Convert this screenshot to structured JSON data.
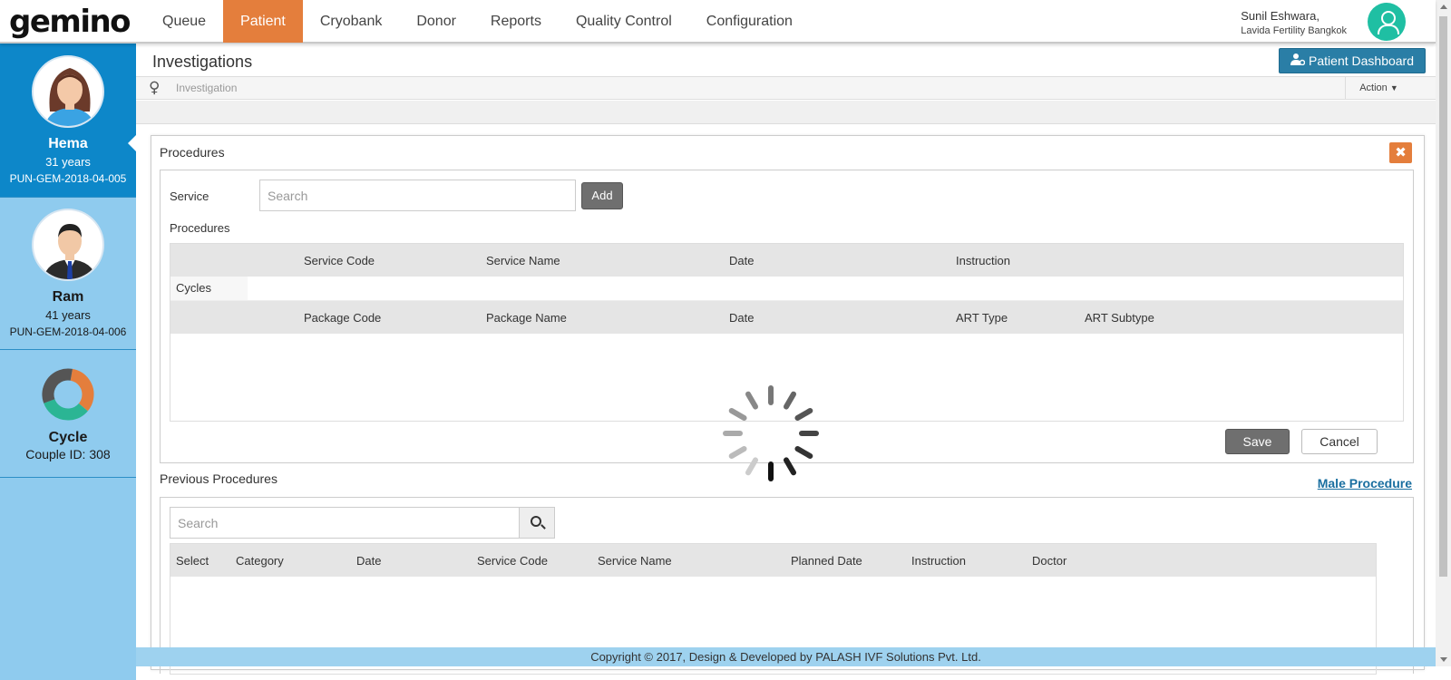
{
  "app": {
    "logo_text": "gemino",
    "nav": [
      "Queue",
      "Patient",
      "Cryobank",
      "Donor",
      "Reports",
      "Quality Control",
      "Configuration"
    ],
    "active_nav": "Patient",
    "user": {
      "name": "Sunil Eshwara,",
      "org": "Lavida Fertility Bangkok"
    }
  },
  "sidebar": {
    "female": {
      "name": "Hema",
      "age": "31 years",
      "id": "PUN-GEM-2018-04-005"
    },
    "male": {
      "name": "Ram",
      "age": "41 years",
      "id": "PUN-GEM-2018-04-006"
    },
    "cycle": {
      "label": "Cycle",
      "couple_id": "Couple ID: 308"
    }
  },
  "page": {
    "title": "Investigations",
    "dashboard_button": "Patient Dashboard",
    "breadcrumb": "Investigation",
    "action_label": "Action"
  },
  "procedures": {
    "title": "Procedures",
    "close_glyph": "✖",
    "service_label": "Service",
    "service_placeholder": "Search",
    "add_button": "Add",
    "sub_label": "Procedures",
    "service_headers": [
      "Service Code",
      "Service Name",
      "Date",
      "Instruction"
    ],
    "cycles_label": "Cycles",
    "package_headers": [
      "Package Code",
      "Package Name",
      "Date",
      "ART Type",
      "ART Subtype"
    ],
    "save_button": "Save",
    "cancel_button": "Cancel"
  },
  "previous": {
    "title": "Previous Procedures",
    "male_link": "Male Procedure",
    "search_placeholder": "Search",
    "headers": [
      "Select",
      "Category",
      "Date",
      "Service Code",
      "Service Name",
      "Planned Date",
      "Instruction",
      "Doctor"
    ]
  },
  "footer": "Copyright © 2017, Design & Developed by PALASH IVF Solutions Pvt. Ltd.",
  "colors": {
    "accent": "#e47e3c",
    "sidebar": "#8fcbee",
    "sidebar_active": "#0d87c9",
    "primary_button": "#2a7ea6"
  }
}
